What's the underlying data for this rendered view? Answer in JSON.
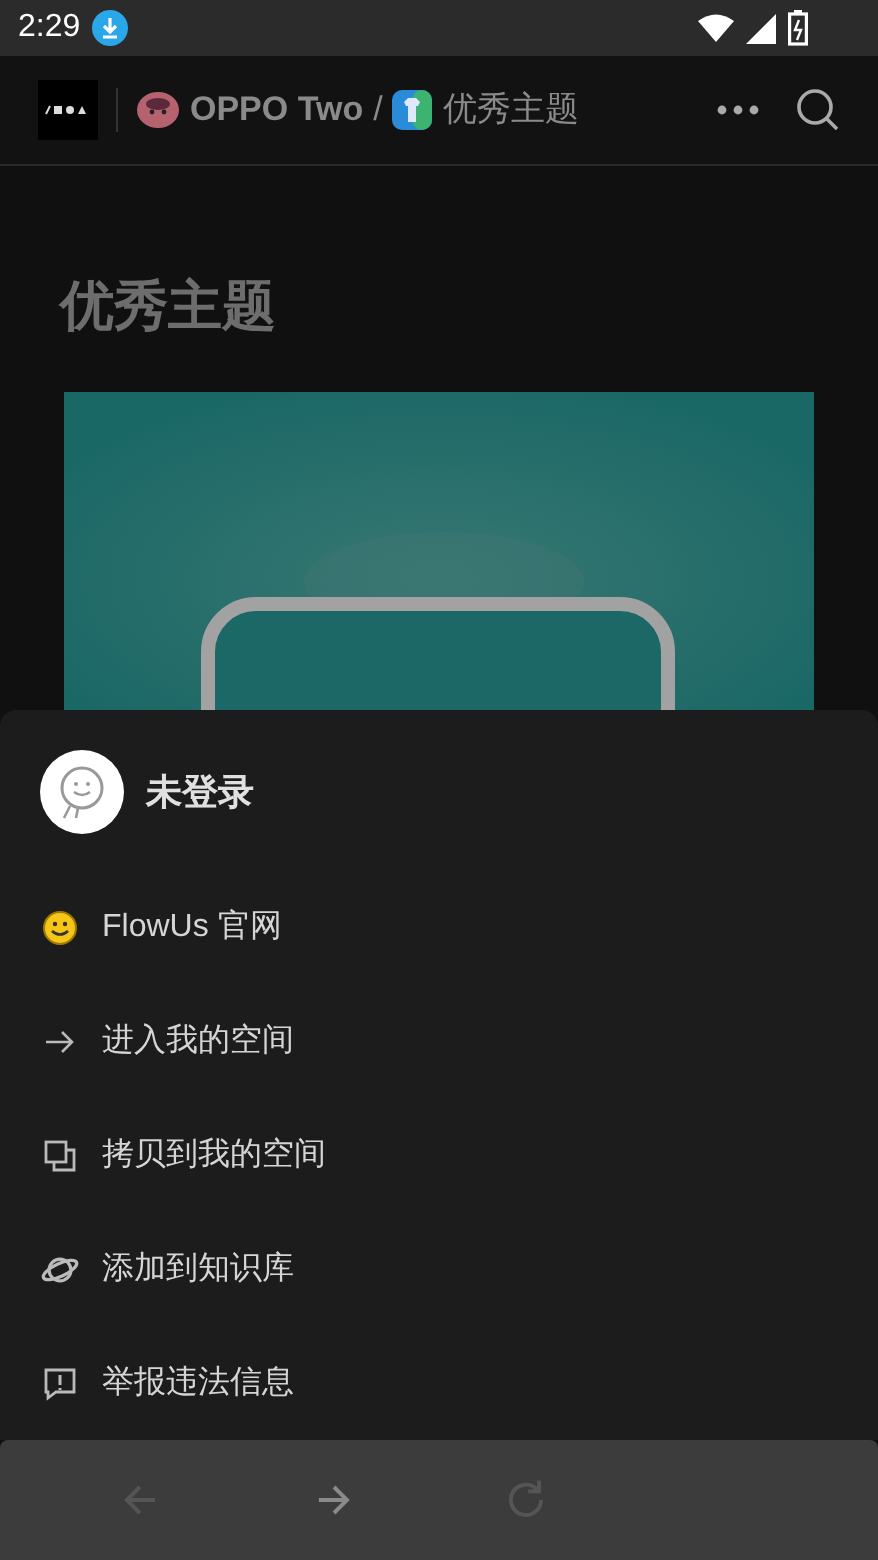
{
  "status_bar": {
    "time": "2:29"
  },
  "header": {
    "breadcrumb": [
      {
        "label": "OPPO Two",
        "kind": "workspace"
      },
      {
        "label": "优秀主题",
        "kind": "page"
      }
    ],
    "separator": "/"
  },
  "page": {
    "title": "优秀主题"
  },
  "sheet": {
    "user": {
      "name": "未登录"
    },
    "items": [
      {
        "label": "FlowUs 官网",
        "kind": "smiley"
      },
      {
        "label": "进入我的空间",
        "kind": "arrow"
      },
      {
        "label": "拷贝到我的空间",
        "kind": "copy"
      },
      {
        "label": "添加到知识库",
        "kind": "planet"
      },
      {
        "label": "举报违法信息",
        "kind": "report"
      }
    ]
  },
  "toolbar": [
    {
      "kind": "back",
      "disabled": true
    },
    {
      "kind": "forward",
      "disabled": false
    },
    {
      "kind": "reload",
      "disabled": true
    }
  ]
}
